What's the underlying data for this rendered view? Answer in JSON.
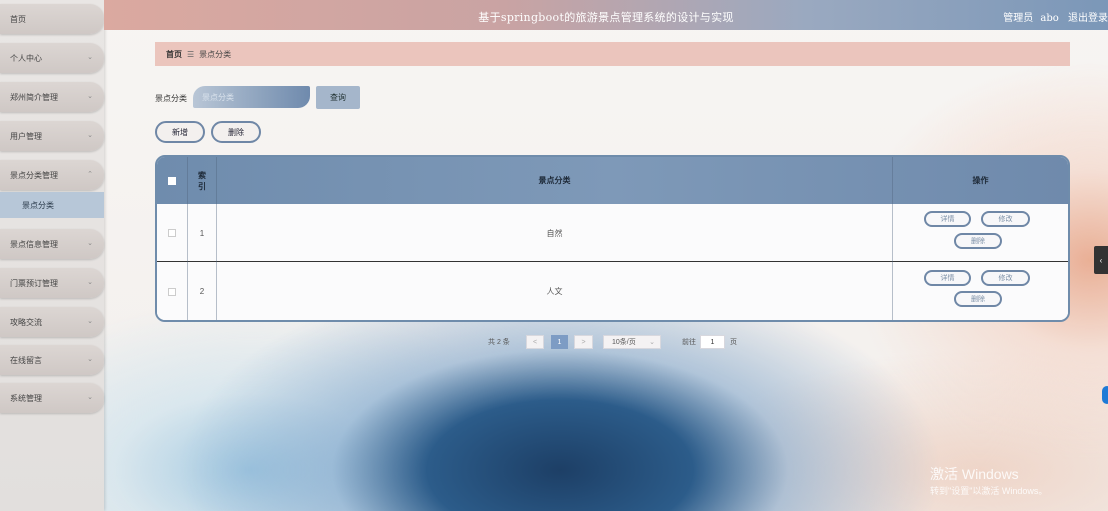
{
  "sidebar": {
    "items": [
      {
        "label": "首页",
        "chevron": ""
      },
      {
        "label": "个人中心",
        "chevron": "⌄"
      },
      {
        "label": "郑州简介管理",
        "chevron": "⌄"
      },
      {
        "label": "用户管理",
        "chevron": "⌄"
      },
      {
        "label": "景点分类管理",
        "chevron": "⌃"
      },
      {
        "label": "景点信息管理",
        "chevron": "⌄"
      },
      {
        "label": "门票预订管理",
        "chevron": "⌄"
      },
      {
        "label": "攻略交流",
        "chevron": "⌄"
      },
      {
        "label": "在线留言",
        "chevron": "⌄"
      },
      {
        "label": "系统管理",
        "chevron": "⌄"
      }
    ],
    "active_sub": "景点分类"
  },
  "header": {
    "title": "基于springboot的旅游景点管理系统的设计与实现",
    "user_role": "管理员",
    "username": "abo",
    "logout": "退出登录"
  },
  "breadcrumb": {
    "home": "首页",
    "separator": "☰",
    "current": "景点分类"
  },
  "search": {
    "label": "景点分类",
    "placeholder": "景点分类",
    "query_label": "查询"
  },
  "actions": {
    "add_label": "新增",
    "delete_label": "删除"
  },
  "table": {
    "columns": {
      "index": "索引",
      "category": "景点分类",
      "ops": "操作"
    },
    "rows": [
      {
        "index": "1",
        "category": "自然"
      },
      {
        "index": "2",
        "category": "人文"
      }
    ],
    "row_actions": {
      "detail": "详情",
      "edit": "修改",
      "delete": "删除"
    }
  },
  "pagination": {
    "total": "共 2 条",
    "prev": "<",
    "current_page": "1",
    "next": ">",
    "page_size": "10条/页",
    "goto_prefix": "前往",
    "goto_value": "1",
    "goto_suffix": "页"
  },
  "watermark": {
    "line1": "激活 Windows",
    "line2": "转到\"设置\"以激活 Windows。"
  },
  "side_tab_icon": "chevron-left-icon",
  "side_tab_glyph": "‹"
}
